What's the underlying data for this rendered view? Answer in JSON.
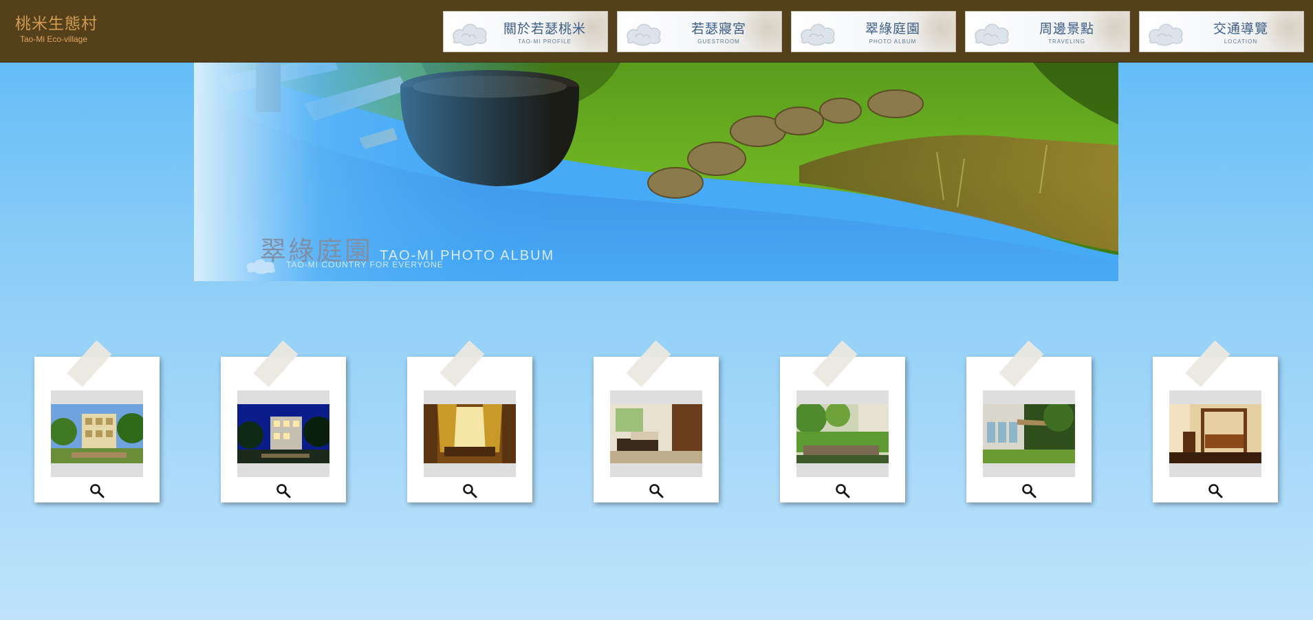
{
  "header": {
    "logo_cn": "桃米生態村",
    "logo_en": "Tao-Mi Eco-village",
    "bg_color": "#54411c",
    "nav": [
      {
        "label": "關於若瑟桃米",
        "sub": "TAO-MI PROFILE"
      },
      {
        "label": "若瑟寢宮",
        "sub": "GUESTROOM"
      },
      {
        "label": "翠綠庭園",
        "sub": "PHOTO ALBUM"
      },
      {
        "label": "周邊景點",
        "sub": "TRAVELING"
      },
      {
        "label": "交通導覽",
        "sub": "LOCATION"
      }
    ]
  },
  "banner": {
    "title_cn": "翠綠庭園",
    "title_en": "TAO-MI PHOTO ALBUM",
    "subtitle": "TAO-MI COUNTRY FOR EVERYONE"
  },
  "gallery": {
    "photos": [
      {
        "scene": "garden-villa-daytime",
        "zoom_icon": "magnifier-icon"
      },
      {
        "scene": "villa-night",
        "zoom_icon": "magnifier-icon"
      },
      {
        "scene": "room-curtains",
        "zoom_icon": "magnifier-icon"
      },
      {
        "scene": "living-room",
        "zoom_icon": "magnifier-icon"
      },
      {
        "scene": "garden-pond",
        "zoom_icon": "magnifier-icon"
      },
      {
        "scene": "patio-lawn",
        "zoom_icon": "magnifier-icon"
      },
      {
        "scene": "canopy-bedroom",
        "zoom_icon": "magnifier-icon"
      }
    ]
  },
  "colors": {
    "sky_top": "#58b8f7",
    "sky_bottom": "#bfe3fb",
    "nav_text": "#3b5d87",
    "logo_text": "#d29b52"
  }
}
